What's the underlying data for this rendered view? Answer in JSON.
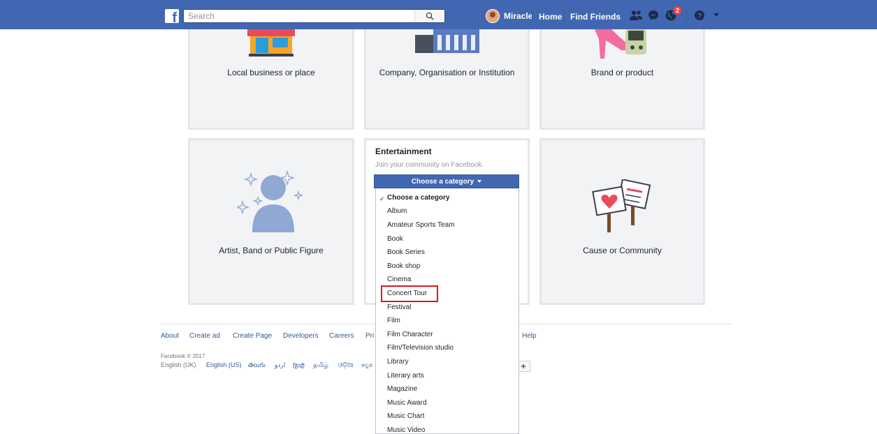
{
  "header": {
    "logo": "f",
    "search_placeholder": "Search",
    "user_name": "Miracle",
    "home": "Home",
    "find_friends": "Find Friends",
    "notification_count": "2"
  },
  "cards": {
    "local_business": "Local business or place",
    "company": "Company, Organisation or Institution",
    "brand": "Brand or product",
    "artist": "Artist, Band or Public Figure",
    "cause": "Cause or Community"
  },
  "entertainment": {
    "title": "Entertainment",
    "subtitle": "Join your community on Facebook.",
    "button_label": "Choose a category",
    "options": [
      "Choose a category",
      "Album",
      "Amateur Sports Team",
      "Book",
      "Book Series",
      "Book shop",
      "Cinema",
      "Concert Tour",
      "Festival",
      "Film",
      "Film Character",
      "Film/Television studio",
      "Library",
      "Literary arts",
      "Magazine",
      "Music Award",
      "Music Chart",
      "Music Video"
    ],
    "selected_option": "Choose a category",
    "highlighted_option": "Concert Tour"
  },
  "footer": {
    "links": [
      "About",
      "Create ad",
      "Create Page",
      "Developers",
      "Careers",
      "Pri",
      "Help"
    ],
    "copyright": "Facebook © 2017",
    "languages": [
      "English (UK)",
      "English (US)",
      "తెలుగు",
      "اردو",
      "हिन्दी",
      "தமிழ்",
      "ଓଡ଼ିଆ",
      "ಕನ್ನಡ"
    ],
    "more_languages": "+"
  },
  "colors": {
    "brand_blue": "#4267b2",
    "card_bg": "#f2f3f5",
    "highlight_red": "#e0141e"
  }
}
